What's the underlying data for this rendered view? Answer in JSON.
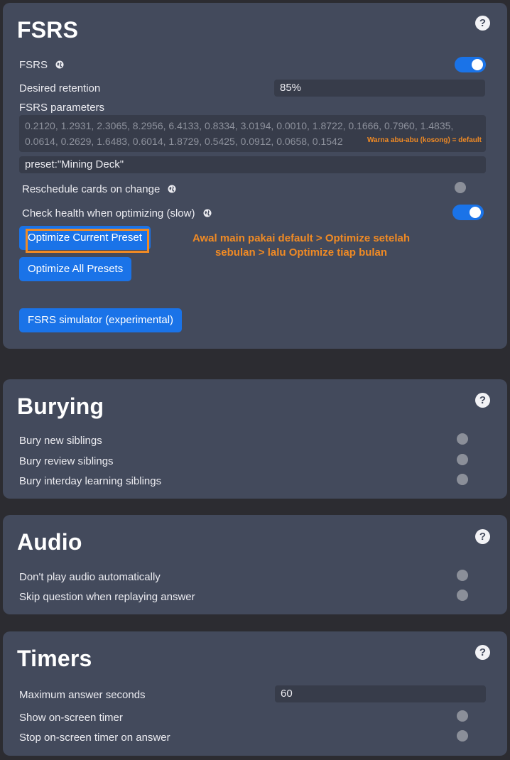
{
  "fsrs": {
    "title": "FSRS",
    "help": "?",
    "fsrs_label": "FSRS",
    "desired_retention_label": "Desired retention",
    "desired_retention_value": "85%",
    "parameters_label": "FSRS parameters",
    "parameters_line1": "0.2120, 1.2931, 2.3065, 8.2956, 6.4133, 0.8334, 3.0194, 0.0010, 1.8722, 0.1666, 0.7960, 1.4835,",
    "parameters_line2": "0.0614, 0.2629, 1.6483, 0.6014, 1.8729, 0.5425, 0.0912, 0.0658, 0.1542",
    "parameters_note": "Warna abu-abu (kosong) = default",
    "search_value": "preset:\"Mining Deck\"",
    "reschedule_label": "Reschedule cards on change",
    "check_health_label": "Check health when optimizing (slow)",
    "optimize_current_label": "Optimize Current Preset",
    "optimize_all_label": "Optimize All Presets",
    "simulator_label": "FSRS simulator (experimental)",
    "annotation_line1": "Awal main pakai default > Optimize setelah",
    "annotation_line2": "sebulan > lalu Optimize tiap bulan",
    "fsrs_enabled": true,
    "reschedule_enabled": false,
    "check_health_enabled": true
  },
  "burying": {
    "title": "Burying",
    "help": "?",
    "bury_new_label": "Bury new siblings",
    "bury_review_label": "Bury review siblings",
    "bury_interday_label": "Bury interday learning siblings"
  },
  "audio": {
    "title": "Audio",
    "help": "?",
    "dont_play_label": "Don't play audio automatically",
    "skip_question_label": "Skip question when replaying answer"
  },
  "timers": {
    "title": "Timers",
    "help": "?",
    "max_answer_label": "Maximum answer seconds",
    "max_answer_value": "60",
    "show_timer_label": "Show on-screen timer",
    "stop_timer_label": "Stop on-screen timer on answer"
  },
  "colors": {
    "accent": "#1a73e8",
    "card_bg": "#434a5c",
    "annotation": "#f08a24"
  }
}
